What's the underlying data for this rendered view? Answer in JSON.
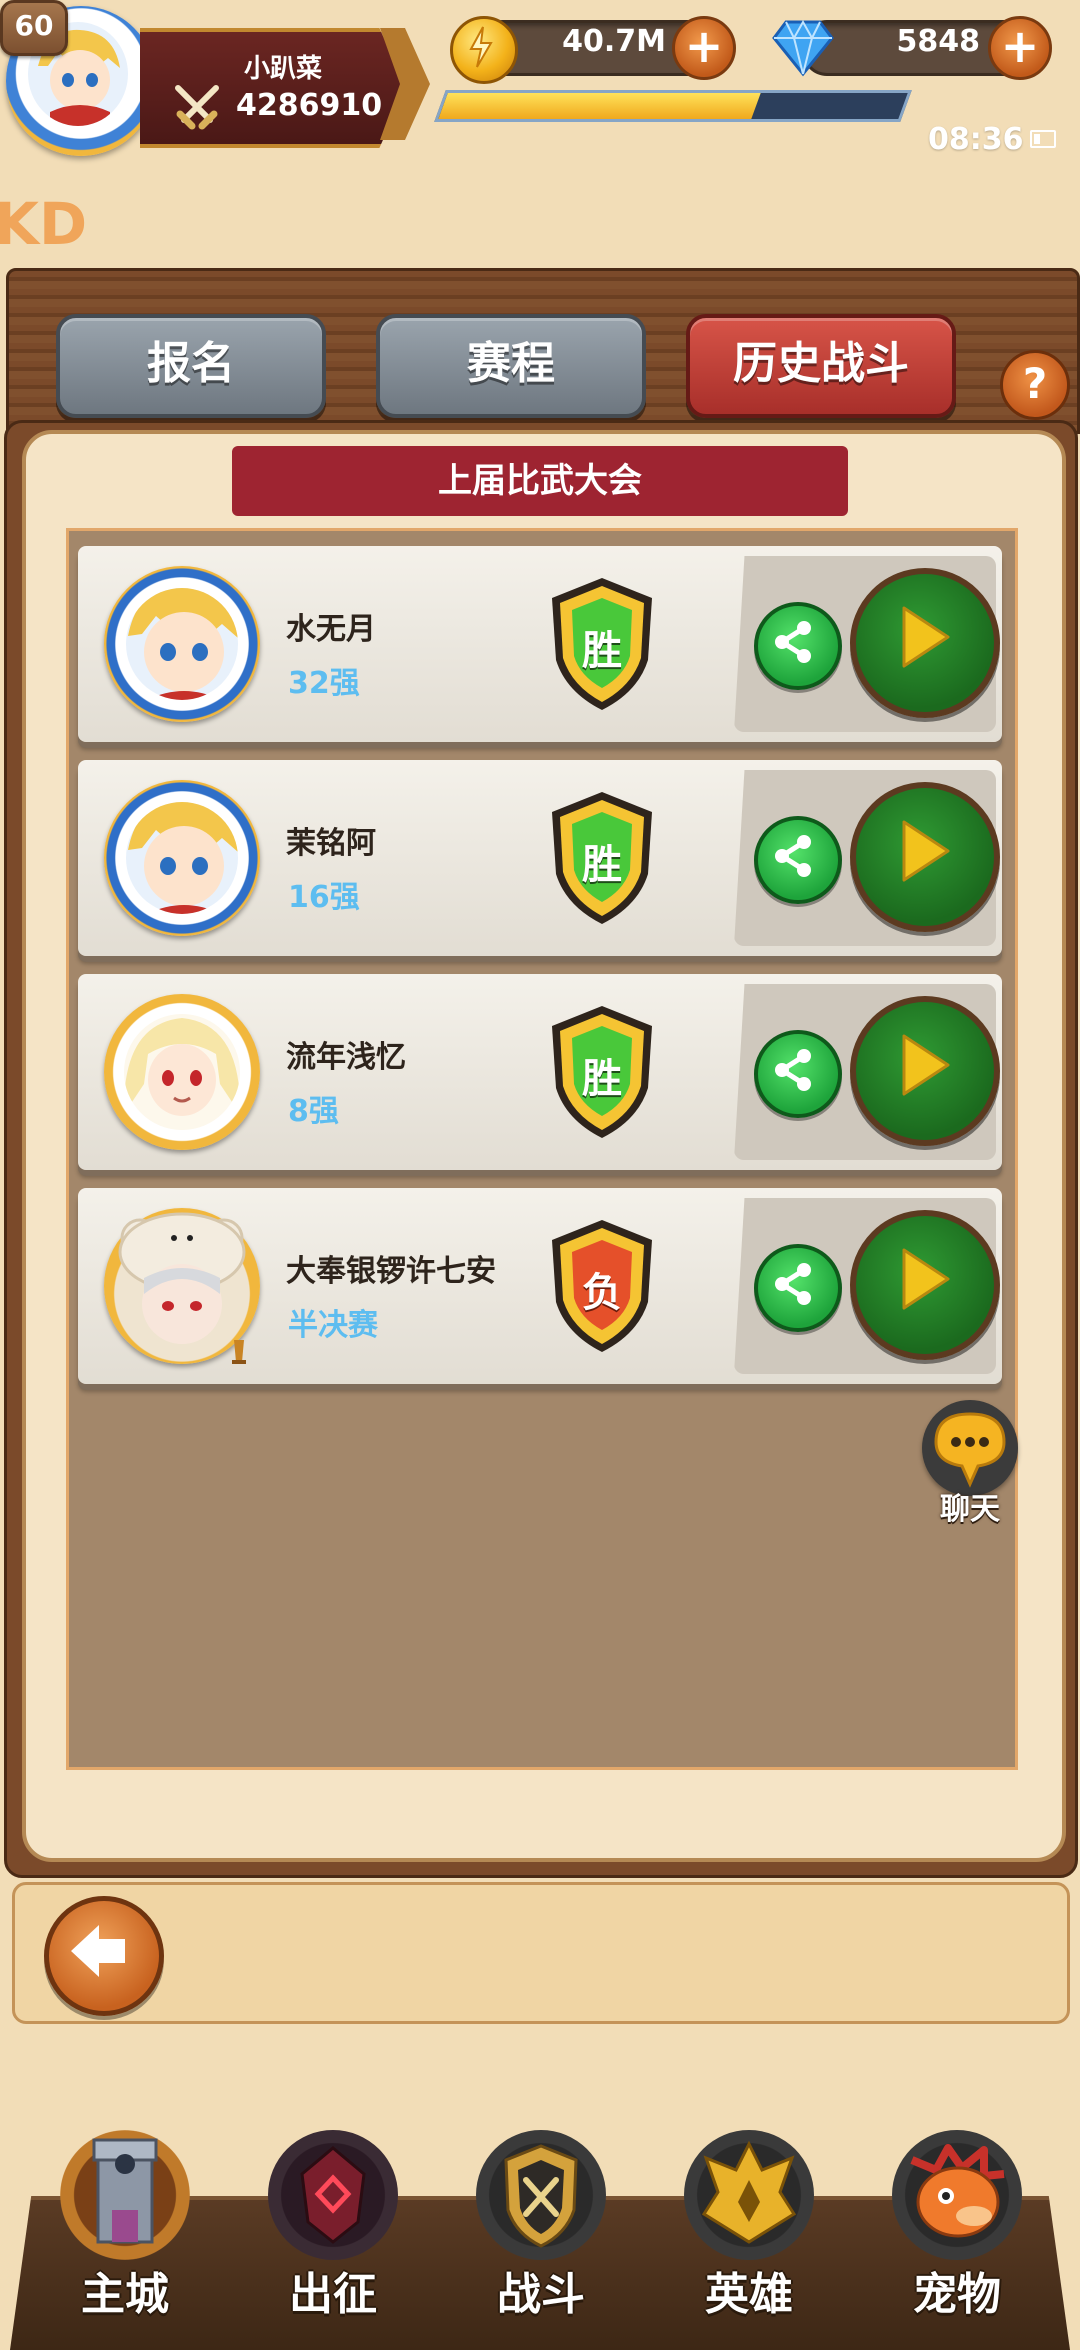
{
  "player": {
    "level": "60",
    "name": "小趴菜",
    "power": "4286910"
  },
  "resources": {
    "gold": "40.7M",
    "gems": "5848",
    "xp_fraction": 0.68
  },
  "status": {
    "time": "08:36"
  },
  "watermark": "KD",
  "tabs": [
    {
      "label": "报名",
      "active": false
    },
    {
      "label": "赛程",
      "active": false
    },
    {
      "label": "历史战斗",
      "active": true
    }
  ],
  "panel": {
    "title": "上届比武大会",
    "rows": [
      {
        "name": "水无月",
        "rank": "32强",
        "result": "胜"
      },
      {
        "name": "茉铭阿",
        "rank": "16强",
        "result": "胜"
      },
      {
        "name": "流年浅忆",
        "rank": "8强",
        "result": "胜"
      },
      {
        "name": "大奉银锣许七安",
        "rank": "半决赛",
        "result": "负"
      }
    ]
  },
  "chat": {
    "label": "聊天"
  },
  "nav": [
    {
      "label": "主城",
      "icon": "castle-icon"
    },
    {
      "label": "出征",
      "icon": "expedition-icon"
    },
    {
      "label": "战斗",
      "icon": "battle-icon"
    },
    {
      "label": "英雄",
      "icon": "hero-icon"
    },
    {
      "label": "宠物",
      "icon": "pet-dragon-icon"
    }
  ],
  "colors": {
    "win_shield": "#49c83a",
    "lose_shield": "#e5502a",
    "rank_text": "#5dbdf0",
    "active_tab": "#c2413a"
  }
}
